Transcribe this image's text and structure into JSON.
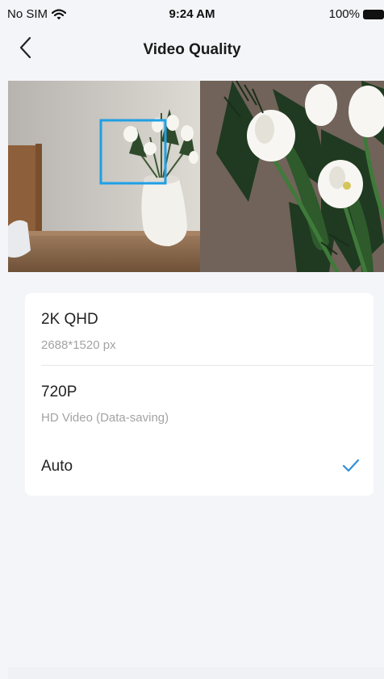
{
  "status_bar": {
    "carrier": "No SIM",
    "time": "9:24 AM",
    "battery": "100%",
    "wifi_icon": "wifi-icon",
    "battery_icon": "battery-full-icon"
  },
  "nav": {
    "title": "Video Quality",
    "back_icon": "chevron-left-icon"
  },
  "options": [
    {
      "title": "2K QHD",
      "subtitle": "2688*1520 px",
      "selected": false
    },
    {
      "title": "720P",
      "subtitle": "HD Video (Data-saving)",
      "selected": false
    },
    {
      "title": "Auto",
      "subtitle": "",
      "selected": true
    }
  ],
  "colors": {
    "accent": "#2f8fd8",
    "selection_box": "#1fa0e6",
    "background": "#f4f5f9"
  }
}
